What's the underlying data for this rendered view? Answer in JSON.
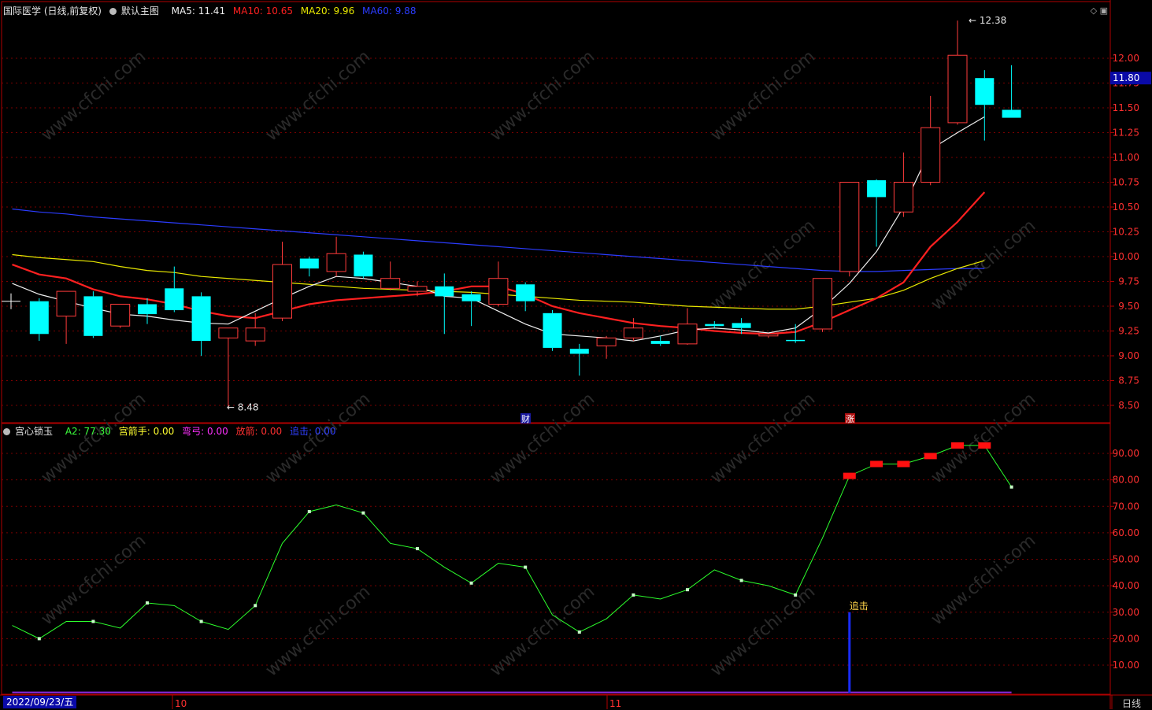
{
  "header": {
    "stock": "国际医学 (日线,前复权)",
    "template": "默认主图",
    "ma": [
      {
        "label": "MA5: 11.41",
        "color": "#f0f0f0"
      },
      {
        "label": "MA10: 10.65",
        "color": "#ff2020"
      },
      {
        "label": "MA20: 9.96",
        "color": "#e8e800"
      },
      {
        "label": "MA60: 9.88",
        "color": "#2b3cff"
      }
    ]
  },
  "indicator_header": {
    "name": "宫心锁玉",
    "items": [
      {
        "label": "A2: 77.30",
        "color": "#3cff3c"
      },
      {
        "label": "宫箭手: 0.00",
        "color": "#ffff30"
      },
      {
        "label": "弯弓: 0.00",
        "color": "#ff30ff"
      },
      {
        "label": "放箭: 0.00",
        "color": "#ff3030"
      },
      {
        "label": "追击: 0.00",
        "color": "#3040ff"
      }
    ]
  },
  "price_labels": {
    "current": "11.80",
    "high": "12.38",
    "low": "8.48"
  },
  "markers": {
    "cai": "财",
    "zhang": "涨",
    "zhuiji": "追击"
  },
  "bottom": {
    "date": "2022/09/23/五",
    "month_oct": "10",
    "month_nov": "11",
    "timeframe": "日线"
  },
  "watermark": "www.cfchi.com",
  "colors": {
    "up": "#ff3b3b",
    "down": "#00ffff",
    "grid": "#7a0000",
    "axis": "#b00000"
  },
  "chart_data": [
    {
      "type": "candlestick",
      "title": "国际医学 (日线,前复权)",
      "y_ticks": [
        8.5,
        8.75,
        9.0,
        9.25,
        9.5,
        9.75,
        10.0,
        10.25,
        10.5,
        10.75,
        11.0,
        11.25,
        11.5,
        11.75,
        12.0
      ],
      "ylim": [
        8.35,
        12.55
      ],
      "x_labels": {
        "0": "2022/09/23/五",
        "6": "10",
        "22": "11"
      },
      "candles": [
        {
          "o": 9.55,
          "h": 9.58,
          "l": 9.15,
          "c": 9.22
        },
        {
          "o": 9.4,
          "h": 9.65,
          "l": 9.12,
          "c": 9.65
        },
        {
          "o": 9.6,
          "h": 9.65,
          "l": 9.18,
          "c": 9.2
        },
        {
          "o": 9.3,
          "h": 9.52,
          "l": 9.28,
          "c": 9.52
        },
        {
          "o": 9.52,
          "h": 9.58,
          "l": 9.32,
          "c": 9.42
        },
        {
          "o": 9.68,
          "h": 9.9,
          "l": 9.44,
          "c": 9.46
        },
        {
          "o": 9.6,
          "h": 9.64,
          "l": 9.0,
          "c": 9.15
        },
        {
          "o": 9.18,
          "h": 9.28,
          "l": 8.48,
          "c": 9.28
        },
        {
          "o": 9.15,
          "h": 9.43,
          "l": 9.1,
          "c": 9.28
        },
        {
          "o": 9.38,
          "h": 10.15,
          "l": 9.35,
          "c": 9.92
        },
        {
          "o": 9.98,
          "h": 10.0,
          "l": 9.8,
          "c": 9.88
        },
        {
          "o": 9.85,
          "h": 10.2,
          "l": 9.8,
          "c": 10.03
        },
        {
          "o": 10.02,
          "h": 10.05,
          "l": 9.78,
          "c": 9.8
        },
        {
          "o": 9.68,
          "h": 9.95,
          "l": 9.66,
          "c": 9.78
        },
        {
          "o": 9.65,
          "h": 9.75,
          "l": 9.6,
          "c": 9.7
        },
        {
          "o": 9.7,
          "h": 9.83,
          "l": 9.22,
          "c": 9.6
        },
        {
          "o": 9.62,
          "h": 9.65,
          "l": 9.3,
          "c": 9.55
        },
        {
          "o": 9.52,
          "h": 9.95,
          "l": 9.5,
          "c": 9.78
        },
        {
          "o": 9.72,
          "h": 9.74,
          "l": 9.45,
          "c": 9.55
        },
        {
          "o": 9.43,
          "h": 9.46,
          "l": 9.05,
          "c": 9.08
        },
        {
          "o": 9.07,
          "h": 9.12,
          "l": 8.8,
          "c": 9.02
        },
        {
          "o": 9.1,
          "h": 9.2,
          "l": 8.97,
          "c": 9.18
        },
        {
          "o": 9.18,
          "h": 9.38,
          "l": 9.15,
          "c": 9.28
        },
        {
          "o": 9.15,
          "h": 9.2,
          "l": 9.1,
          "c": 9.12
        },
        {
          "o": 9.12,
          "h": 9.48,
          "l": 9.11,
          "c": 9.32
        },
        {
          "o": 9.32,
          "h": 9.35,
          "l": 9.28,
          "c": 9.3
        },
        {
          "o": 9.33,
          "h": 9.38,
          "l": 9.22,
          "c": 9.28
        },
        {
          "o": 9.2,
          "h": 9.22,
          "l": 9.18,
          "c": 9.22
        },
        {
          "o": 9.16,
          "h": 9.32,
          "l": 9.13,
          "c": 9.15
        },
        {
          "o": 9.27,
          "h": 9.78,
          "l": 9.24,
          "c": 9.78
        },
        {
          "o": 9.85,
          "h": 10.03,
          "l": 9.8,
          "c": 10.75
        },
        {
          "o": 10.77,
          "h": 10.78,
          "l": 10.1,
          "c": 10.6
        },
        {
          "o": 10.45,
          "h": 11.05,
          "l": 10.4,
          "c": 10.75
        },
        {
          "o": 10.75,
          "h": 11.62,
          "l": 10.72,
          "c": 11.3
        },
        {
          "o": 11.35,
          "h": 12.38,
          "l": 11.33,
          "c": 12.03
        },
        {
          "o": 11.8,
          "h": 11.88,
          "l": 11.17,
          "c": 11.53
        },
        {
          "o": 11.48,
          "h": 11.93,
          "l": 11.4,
          "c": 11.4
        }
      ],
      "ma5": [
        9.73,
        9.62,
        9.55,
        9.48,
        9.42,
        9.4,
        9.36,
        9.33,
        9.32,
        9.45,
        9.58,
        9.7,
        9.8,
        9.78,
        9.74,
        9.7,
        9.6,
        9.58,
        9.45,
        9.32,
        9.22,
        9.2,
        9.18,
        9.15,
        9.2,
        9.26,
        9.28,
        9.26,
        9.23,
        9.28,
        9.48,
        9.73,
        10.05,
        10.5,
        11.08,
        11.25,
        11.41
      ],
      "ma10": [
        9.92,
        9.82,
        9.78,
        9.67,
        9.6,
        9.57,
        9.52,
        9.45,
        9.4,
        9.38,
        9.45,
        9.52,
        9.56,
        9.58,
        9.6,
        9.62,
        9.65,
        9.7,
        9.7,
        9.62,
        9.5,
        9.43,
        9.38,
        9.33,
        9.3,
        9.28,
        9.25,
        9.23,
        9.22,
        9.24,
        9.34,
        9.46,
        9.58,
        9.74,
        10.1,
        10.35,
        10.65
      ],
      "ma20": [
        10.02,
        9.99,
        9.97,
        9.95,
        9.9,
        9.86,
        9.84,
        9.8,
        9.78,
        9.76,
        9.74,
        9.72,
        9.7,
        9.68,
        9.67,
        9.66,
        9.65,
        9.64,
        9.62,
        9.6,
        9.58,
        9.56,
        9.55,
        9.54,
        9.52,
        9.5,
        9.49,
        9.48,
        9.47,
        9.47,
        9.5,
        9.54,
        9.58,
        9.66,
        9.78,
        9.88,
        9.96
      ],
      "ma60": [
        10.48,
        10.45,
        10.43,
        10.4,
        10.38,
        10.36,
        10.34,
        10.32,
        10.3,
        10.28,
        10.26,
        10.24,
        10.22,
        10.2,
        10.18,
        10.16,
        10.14,
        10.12,
        10.1,
        10.08,
        10.06,
        10.04,
        10.02,
        10.0,
        9.98,
        9.96,
        9.94,
        9.92,
        9.9,
        9.88,
        9.86,
        9.85,
        9.85,
        9.86,
        9.87,
        9.88,
        9.88
      ]
    },
    {
      "type": "line",
      "title": "宫心锁玉",
      "y_ticks": [
        10,
        20,
        30,
        40,
        50,
        60,
        70,
        80,
        90
      ],
      "ylim": [
        0,
        100
      ],
      "series": [
        {
          "name": "A2",
          "values": [
            25,
            20,
            26.5,
            26.5,
            24,
            33.5,
            32.5,
            26.5,
            23.5,
            32.5,
            56,
            68,
            70.5,
            67.5,
            56,
            54,
            47,
            41,
            48.5,
            47,
            29,
            22.5,
            27.5,
            36.5,
            35,
            38.5,
            46,
            42,
            40,
            36.5,
            58,
            81.5,
            86,
            86,
            89,
            93,
            93,
            77.3
          ]
        },
        {
          "name": "追击",
          "values": [
            0,
            0,
            0,
            0,
            0,
            0,
            0,
            0,
            0,
            0,
            0,
            0,
            0,
            0,
            0,
            0,
            0,
            0,
            0,
            0,
            0,
            0,
            0,
            0,
            0,
            0,
            0,
            0,
            0,
            0,
            0,
            30,
            0,
            0,
            0,
            0,
            0,
            0
          ]
        }
      ],
      "red_bars_at": [
        31,
        32,
        33,
        34,
        35,
        36
      ]
    }
  ]
}
